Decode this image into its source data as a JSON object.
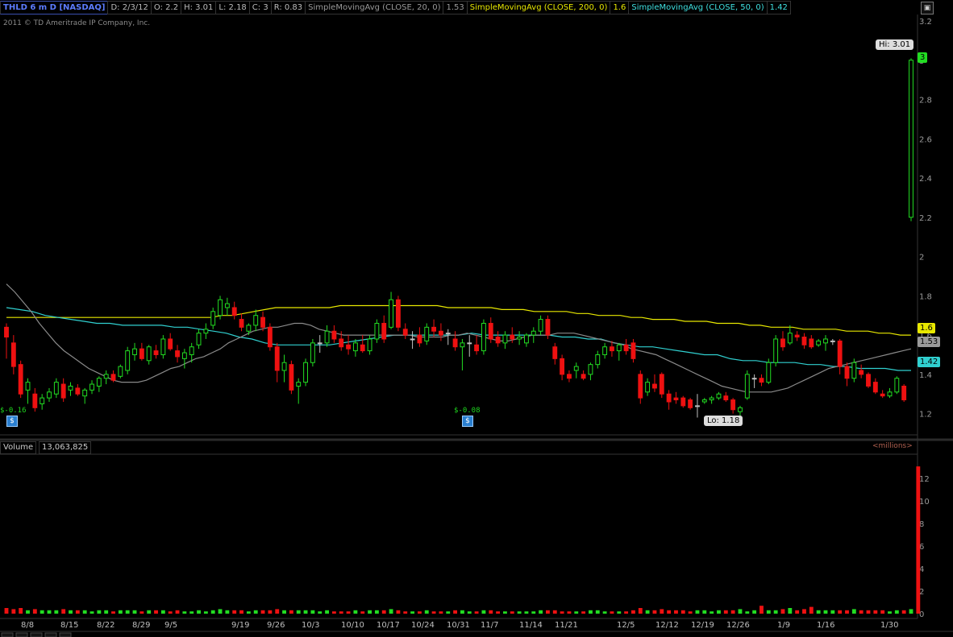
{
  "header": {
    "symbol": "THLD 6 m D [NASDAQ]",
    "date": "D: 2/3/12",
    "open": "O: 2.2",
    "high": "H: 3.01",
    "low": "L: 2.18",
    "close": "C: 3",
    "range": "R: 0.83",
    "sma20_label": "SimpleMovingAvg (CLOSE, 20, 0)",
    "sma20_value": "1.53",
    "sma200_label": "SimpleMovingAvg (CLOSE, 200, 0)",
    "sma200_value": "1.6",
    "sma50_label": "SimpleMovingAvg (CLOSE, 50, 0)",
    "sma50_value": "1.42"
  },
  "copyright": "2011 © TD Ameritrade IP Company, Inc.",
  "volume_header": {
    "label": "Volume",
    "value": "13,063,825",
    "units": "<millions>"
  },
  "annotations": {
    "hi": "Hi: 3.01",
    "lo": "Lo: 1.18",
    "earn1": "$-0.16",
    "earn2": "$-0.08",
    "earn_icon": "$",
    "tag_last": "3",
    "tag_sma200": "1.6",
    "tag_sma20": "1.53",
    "tag_sma50": "1.42"
  },
  "colors": {
    "up": "#22dd22",
    "down": "#ee1111",
    "neutral": "#c0c0c0",
    "sma20": "#8a8a8a",
    "sma200": "#e8e800",
    "sma50": "#30d0d0",
    "tag_last_bg": "#22dd22",
    "tag_sma200_bg": "#e8e800",
    "tag_sma20_bg": "#9a9a9a",
    "tag_sma50_bg": "#30d0d0"
  },
  "chart_data": {
    "type": "candlestick",
    "price_axis": {
      "ylim": [
        1.1,
        3.2
      ],
      "ticks": [
        "3.2",
        "3",
        "2.8",
        "2.6",
        "2.4",
        "2.2",
        "2",
        "1.8",
        "1.6",
        "1.4",
        "1.2"
      ]
    },
    "volume_axis": {
      "ylim": [
        0,
        14
      ],
      "ticks": [
        "12",
        "10",
        "8",
        "6",
        "4",
        "2",
        "0"
      ]
    },
    "time_axis": [
      "8/8",
      "8/15",
      "8/22",
      "8/29",
      "9/5",
      "9/19",
      "9/26",
      "10/3",
      "10/10",
      "10/17",
      "10/24",
      "10/31",
      "11/7",
      "11/14",
      "11/21",
      "12/5",
      "12/12",
      "12/19",
      "12/26",
      "1/9",
      "1/16",
      "1/30"
    ],
    "candles": [
      {
        "o": 1.64,
        "h": 1.66,
        "l": 1.48,
        "c": 1.59
      },
      {
        "o": 1.56,
        "h": 1.6,
        "l": 1.4,
        "c": 1.44
      },
      {
        "o": 1.45,
        "h": 1.47,
        "l": 1.28,
        "c": 1.3
      },
      {
        "o": 1.32,
        "h": 1.38,
        "l": 1.25,
        "c": 1.36
      },
      {
        "o": 1.3,
        "h": 1.33,
        "l": 1.21,
        "c": 1.23
      },
      {
        "o": 1.25,
        "h": 1.3,
        "l": 1.22,
        "c": 1.28
      },
      {
        "o": 1.28,
        "h": 1.33,
        "l": 1.26,
        "c": 1.31
      },
      {
        "o": 1.3,
        "h": 1.38,
        "l": 1.28,
        "c": 1.36
      },
      {
        "o": 1.35,
        "h": 1.38,
        "l": 1.26,
        "c": 1.28
      },
      {
        "o": 1.32,
        "h": 1.36,
        "l": 1.29,
        "c": 1.34
      },
      {
        "o": 1.33,
        "h": 1.35,
        "l": 1.29,
        "c": 1.3
      },
      {
        "o": 1.29,
        "h": 1.33,
        "l": 1.25,
        "c": 1.32
      },
      {
        "o": 1.32,
        "h": 1.37,
        "l": 1.3,
        "c": 1.35
      },
      {
        "o": 1.34,
        "h": 1.39,
        "l": 1.31,
        "c": 1.38
      },
      {
        "o": 1.38,
        "h": 1.42,
        "l": 1.35,
        "c": 1.4
      },
      {
        "o": 1.4,
        "h": 1.42,
        "l": 1.36,
        "c": 1.37
      },
      {
        "o": 1.39,
        "h": 1.45,
        "l": 1.38,
        "c": 1.44
      },
      {
        "o": 1.42,
        "h": 1.54,
        "l": 1.4,
        "c": 1.52
      },
      {
        "o": 1.5,
        "h": 1.56,
        "l": 1.47,
        "c": 1.53
      },
      {
        "o": 1.53,
        "h": 1.56,
        "l": 1.47,
        "c": 1.48
      },
      {
        "o": 1.47,
        "h": 1.55,
        "l": 1.45,
        "c": 1.54
      },
      {
        "o": 1.52,
        "h": 1.55,
        "l": 1.48,
        "c": 1.5
      },
      {
        "o": 1.5,
        "h": 1.6,
        "l": 1.48,
        "c": 1.58
      },
      {
        "o": 1.58,
        "h": 1.61,
        "l": 1.52,
        "c": 1.53
      },
      {
        "o": 1.52,
        "h": 1.55,
        "l": 1.46,
        "c": 1.49
      },
      {
        "o": 1.48,
        "h": 1.53,
        "l": 1.43,
        "c": 1.51
      },
      {
        "o": 1.5,
        "h": 1.56,
        "l": 1.46,
        "c": 1.54
      },
      {
        "o": 1.55,
        "h": 1.63,
        "l": 1.53,
        "c": 1.61
      },
      {
        "o": 1.61,
        "h": 1.66,
        "l": 1.58,
        "c": 1.63
      },
      {
        "o": 1.65,
        "h": 1.74,
        "l": 1.63,
        "c": 1.72
      },
      {
        "o": 1.7,
        "h": 1.8,
        "l": 1.68,
        "c": 1.78
      },
      {
        "o": 1.74,
        "h": 1.79,
        "l": 1.7,
        "c": 1.76
      },
      {
        "o": 1.74,
        "h": 1.77,
        "l": 1.68,
        "c": 1.7
      },
      {
        "o": 1.68,
        "h": 1.71,
        "l": 1.62,
        "c": 1.64
      },
      {
        "o": 1.62,
        "h": 1.66,
        "l": 1.6,
        "c": 1.65
      },
      {
        "o": 1.65,
        "h": 1.73,
        "l": 1.62,
        "c": 1.7
      },
      {
        "o": 1.69,
        "h": 1.72,
        "l": 1.62,
        "c": 1.64
      },
      {
        "o": 1.64,
        "h": 1.66,
        "l": 1.52,
        "c": 1.54
      },
      {
        "o": 1.54,
        "h": 1.56,
        "l": 1.36,
        "c": 1.42
      },
      {
        "o": 1.42,
        "h": 1.5,
        "l": 1.36,
        "c": 1.46
      },
      {
        "o": 1.45,
        "h": 1.47,
        "l": 1.3,
        "c": 1.32
      },
      {
        "o": 1.34,
        "h": 1.38,
        "l": 1.25,
        "c": 1.36
      },
      {
        "o": 1.36,
        "h": 1.48,
        "l": 1.34,
        "c": 1.46
      },
      {
        "o": 1.46,
        "h": 1.58,
        "l": 1.44,
        "c": 1.56
      },
      {
        "o": 1.56,
        "h": 1.6,
        "l": 1.51,
        "c": 1.56
      },
      {
        "o": 1.56,
        "h": 1.65,
        "l": 1.54,
        "c": 1.62
      },
      {
        "o": 1.62,
        "h": 1.65,
        "l": 1.56,
        "c": 1.58
      },
      {
        "o": 1.58,
        "h": 1.62,
        "l": 1.52,
        "c": 1.54
      },
      {
        "o": 1.55,
        "h": 1.6,
        "l": 1.5,
        "c": 1.53
      },
      {
        "o": 1.52,
        "h": 1.58,
        "l": 1.49,
        "c": 1.56
      },
      {
        "o": 1.55,
        "h": 1.6,
        "l": 1.51,
        "c": 1.52
      },
      {
        "o": 1.52,
        "h": 1.6,
        "l": 1.5,
        "c": 1.58
      },
      {
        "o": 1.58,
        "h": 1.68,
        "l": 1.56,
        "c": 1.66
      },
      {
        "o": 1.66,
        "h": 1.7,
        "l": 1.56,
        "c": 1.58
      },
      {
        "o": 1.64,
        "h": 1.82,
        "l": 1.63,
        "c": 1.78
      },
      {
        "o": 1.78,
        "h": 1.8,
        "l": 1.62,
        "c": 1.64
      },
      {
        "o": 1.63,
        "h": 1.66,
        "l": 1.58,
        "c": 1.6
      },
      {
        "o": 1.58,
        "h": 1.62,
        "l": 1.53,
        "c": 1.58
      },
      {
        "o": 1.6,
        "h": 1.64,
        "l": 1.54,
        "c": 1.56
      },
      {
        "o": 1.57,
        "h": 1.66,
        "l": 1.55,
        "c": 1.64
      },
      {
        "o": 1.64,
        "h": 1.68,
        "l": 1.59,
        "c": 1.62
      },
      {
        "o": 1.62,
        "h": 1.66,
        "l": 1.57,
        "c": 1.6
      },
      {
        "o": 1.61,
        "h": 1.63,
        "l": 1.55,
        "c": 1.61
      },
      {
        "o": 1.58,
        "h": 1.62,
        "l": 1.52,
        "c": 1.54
      },
      {
        "o": 1.54,
        "h": 1.58,
        "l": 1.42,
        "c": 1.56
      },
      {
        "o": 1.56,
        "h": 1.6,
        "l": 1.49,
        "c": 1.56
      },
      {
        "o": 1.55,
        "h": 1.6,
        "l": 1.5,
        "c": 1.52
      },
      {
        "o": 1.52,
        "h": 1.68,
        "l": 1.5,
        "c": 1.66
      },
      {
        "o": 1.66,
        "h": 1.69,
        "l": 1.56,
        "c": 1.58
      },
      {
        "o": 1.59,
        "h": 1.62,
        "l": 1.54,
        "c": 1.56
      },
      {
        "o": 1.56,
        "h": 1.62,
        "l": 1.53,
        "c": 1.6
      },
      {
        "o": 1.6,
        "h": 1.64,
        "l": 1.56,
        "c": 1.58
      },
      {
        "o": 1.58,
        "h": 1.62,
        "l": 1.55,
        "c": 1.59
      },
      {
        "o": 1.56,
        "h": 1.61,
        "l": 1.54,
        "c": 1.6
      },
      {
        "o": 1.6,
        "h": 1.64,
        "l": 1.56,
        "c": 1.62
      },
      {
        "o": 1.62,
        "h": 1.7,
        "l": 1.6,
        "c": 1.68
      },
      {
        "o": 1.68,
        "h": 1.7,
        "l": 1.58,
        "c": 1.6
      },
      {
        "o": 1.54,
        "h": 1.56,
        "l": 1.45,
        "c": 1.48
      },
      {
        "o": 1.48,
        "h": 1.5,
        "l": 1.37,
        "c": 1.4
      },
      {
        "o": 1.4,
        "h": 1.42,
        "l": 1.36,
        "c": 1.38
      },
      {
        "o": 1.42,
        "h": 1.46,
        "l": 1.38,
        "c": 1.44
      },
      {
        "o": 1.4,
        "h": 1.42,
        "l": 1.37,
        "c": 1.38
      },
      {
        "o": 1.4,
        "h": 1.46,
        "l": 1.37,
        "c": 1.45
      },
      {
        "o": 1.45,
        "h": 1.52,
        "l": 1.43,
        "c": 1.5
      },
      {
        "o": 1.5,
        "h": 1.56,
        "l": 1.48,
        "c": 1.54
      },
      {
        "o": 1.54,
        "h": 1.57,
        "l": 1.49,
        "c": 1.52
      },
      {
        "o": 1.52,
        "h": 1.56,
        "l": 1.47,
        "c": 1.55
      },
      {
        "o": 1.55,
        "h": 1.58,
        "l": 1.5,
        "c": 1.52
      },
      {
        "o": 1.56,
        "h": 1.58,
        "l": 1.46,
        "c": 1.48
      },
      {
        "o": 1.4,
        "h": 1.42,
        "l": 1.25,
        "c": 1.28
      },
      {
        "o": 1.31,
        "h": 1.38,
        "l": 1.29,
        "c": 1.36
      },
      {
        "o": 1.35,
        "h": 1.4,
        "l": 1.31,
        "c": 1.33
      },
      {
        "o": 1.4,
        "h": 1.41,
        "l": 1.28,
        "c": 1.3
      },
      {
        "o": 1.3,
        "h": 1.32,
        "l": 1.22,
        "c": 1.26
      },
      {
        "o": 1.28,
        "h": 1.31,
        "l": 1.25,
        "c": 1.27
      },
      {
        "o": 1.28,
        "h": 1.29,
        "l": 1.23,
        "c": 1.24
      },
      {
        "o": 1.27,
        "h": 1.28,
        "l": 1.22,
        "c": 1.23
      },
      {
        "o": 1.24,
        "h": 1.3,
        "l": 1.18,
        "c": 1.24
      },
      {
        "o": 1.26,
        "h": 1.28,
        "l": 1.25,
        "c": 1.27
      },
      {
        "o": 1.27,
        "h": 1.29,
        "l": 1.25,
        "c": 1.28
      },
      {
        "o": 1.28,
        "h": 1.31,
        "l": 1.27,
        "c": 1.3
      },
      {
        "o": 1.29,
        "h": 1.31,
        "l": 1.26,
        "c": 1.27
      },
      {
        "o": 1.27,
        "h": 1.28,
        "l": 1.2,
        "c": 1.22
      },
      {
        "o": 1.21,
        "h": 1.24,
        "l": 1.19,
        "c": 1.23
      },
      {
        "o": 1.28,
        "h": 1.42,
        "l": 1.27,
        "c": 1.4
      },
      {
        "o": 1.38,
        "h": 1.4,
        "l": 1.33,
        "c": 1.38
      },
      {
        "o": 1.38,
        "h": 1.4,
        "l": 1.34,
        "c": 1.36
      },
      {
        "o": 1.36,
        "h": 1.48,
        "l": 1.35,
        "c": 1.46
      },
      {
        "o": 1.46,
        "h": 1.6,
        "l": 1.44,
        "c": 1.58
      },
      {
        "o": 1.58,
        "h": 1.62,
        "l": 1.52,
        "c": 1.54
      },
      {
        "o": 1.56,
        "h": 1.65,
        "l": 1.55,
        "c": 1.61
      },
      {
        "o": 1.6,
        "h": 1.62,
        "l": 1.57,
        "c": 1.59
      },
      {
        "o": 1.59,
        "h": 1.61,
        "l": 1.53,
        "c": 1.55
      },
      {
        "o": 1.58,
        "h": 1.6,
        "l": 1.53,
        "c": 1.54
      },
      {
        "o": 1.55,
        "h": 1.58,
        "l": 1.54,
        "c": 1.57
      },
      {
        "o": 1.56,
        "h": 1.6,
        "l": 1.52,
        "c": 1.58
      },
      {
        "o": 1.57,
        "h": 1.58,
        "l": 1.55,
        "c": 1.57
      },
      {
        "o": 1.57,
        "h": 1.58,
        "l": 1.4,
        "c": 1.44
      },
      {
        "o": 1.44,
        "h": 1.46,
        "l": 1.34,
        "c": 1.38
      },
      {
        "o": 1.38,
        "h": 1.48,
        "l": 1.36,
        "c": 1.46
      },
      {
        "o": 1.42,
        "h": 1.45,
        "l": 1.38,
        "c": 1.4
      },
      {
        "o": 1.4,
        "h": 1.41,
        "l": 1.33,
        "c": 1.34
      },
      {
        "o": 1.36,
        "h": 1.38,
        "l": 1.3,
        "c": 1.31
      },
      {
        "o": 1.3,
        "h": 1.32,
        "l": 1.28,
        "c": 1.29
      },
      {
        "o": 1.29,
        "h": 1.33,
        "l": 1.28,
        "c": 1.31
      },
      {
        "o": 1.31,
        "h": 1.39,
        "l": 1.3,
        "c": 1.38
      },
      {
        "o": 1.34,
        "h": 1.35,
        "l": 1.26,
        "c": 1.27
      },
      {
        "o": 2.2,
        "h": 3.01,
        "l": 2.18,
        "c": 3.0
      }
    ],
    "volume": [
      0.5,
      0.4,
      0.5,
      0.3,
      0.4,
      0.3,
      0.3,
      0.3,
      0.4,
      0.3,
      0.3,
      0.3,
      0.2,
      0.3,
      0.3,
      0.2,
      0.3,
      0.3,
      0.3,
      0.2,
      0.3,
      0.3,
      0.3,
      0.2,
      0.3,
      0.2,
      0.2,
      0.3,
      0.2,
      0.3,
      0.4,
      0.3,
      0.3,
      0.3,
      0.2,
      0.3,
      0.3,
      0.3,
      0.4,
      0.3,
      0.3,
      0.3,
      0.3,
      0.3,
      0.2,
      0.3,
      0.2,
      0.2,
      0.2,
      0.3,
      0.2,
      0.3,
      0.3,
      0.3,
      0.4,
      0.3,
      0.2,
      0.2,
      0.2,
      0.3,
      0.2,
      0.2,
      0.2,
      0.3,
      0.3,
      0.2,
      0.2,
      0.3,
      0.3,
      0.2,
      0.2,
      0.2,
      0.2,
      0.2,
      0.2,
      0.3,
      0.3,
      0.3,
      0.2,
      0.2,
      0.2,
      0.2,
      0.3,
      0.3,
      0.2,
      0.2,
      0.2,
      0.2,
      0.3,
      0.5,
      0.3,
      0.3,
      0.4,
      0.3,
      0.3,
      0.3,
      0.2,
      0.3,
      0.3,
      0.2,
      0.3,
      0.3,
      0.3,
      0.4,
      0.2,
      0.3,
      0.7,
      0.3,
      0.3,
      0.4,
      0.5,
      0.3,
      0.4,
      0.6,
      0.3,
      0.3,
      0.3,
      0.3,
      0.3,
      0.4,
      0.3,
      0.3,
      0.3,
      0.3,
      0.2,
      0.3,
      0.3,
      0.4,
      13.06
    ],
    "sma20": [
      1.86,
      1.82,
      1.77,
      1.72,
      1.66,
      1.61,
      1.56,
      1.52,
      1.49,
      1.46,
      1.43,
      1.41,
      1.39,
      1.37,
      1.36,
      1.36,
      1.36,
      1.37,
      1.39,
      1.41,
      1.43,
      1.44,
      1.46,
      1.48,
      1.49,
      1.51,
      1.53,
      1.56,
      1.58,
      1.6,
      1.62,
      1.63,
      1.64,
      1.64,
      1.65,
      1.66,
      1.66,
      1.65,
      1.63,
      1.62,
      1.61,
      1.6,
      1.6,
      1.6,
      1.6,
      1.6,
      1.6,
      1.6,
      1.6,
      1.6,
      1.59,
      1.59,
      1.59,
      1.59,
      1.6,
      1.6,
      1.61,
      1.6,
      1.59,
      1.58,
      1.57,
      1.57,
      1.58,
      1.59,
      1.6,
      1.6,
      1.6,
      1.61,
      1.61,
      1.61,
      1.6,
      1.59,
      1.58,
      1.57,
      1.56,
      1.55,
      1.53,
      1.52,
      1.51,
      1.5,
      1.48,
      1.46,
      1.44,
      1.42,
      1.4,
      1.38,
      1.36,
      1.34,
      1.33,
      1.32,
      1.31,
      1.31,
      1.31,
      1.31,
      1.32,
      1.33,
      1.35,
      1.37,
      1.39,
      1.41,
      1.43,
      1.44,
      1.45,
      1.46,
      1.47,
      1.48,
      1.49,
      1.5,
      1.51,
      1.52,
      1.53
    ],
    "sma200": [
      1.69,
      1.69,
      1.69,
      1.69,
      1.69,
      1.69,
      1.69,
      1.69,
      1.69,
      1.69,
      1.69,
      1.69,
      1.69,
      1.69,
      1.69,
      1.69,
      1.69,
      1.69,
      1.69,
      1.69,
      1.7,
      1.7,
      1.71,
      1.72,
      1.73,
      1.74,
      1.74,
      1.74,
      1.74,
      1.74,
      1.74,
      1.75,
      1.75,
      1.75,
      1.75,
      1.75,
      1.75,
      1.75,
      1.75,
      1.75,
      1.75,
      1.74,
      1.74,
      1.74,
      1.74,
      1.74,
      1.73,
      1.73,
      1.73,
      1.72,
      1.72,
      1.72,
      1.72,
      1.71,
      1.71,
      1.7,
      1.7,
      1.7,
      1.69,
      1.69,
      1.68,
      1.68,
      1.68,
      1.67,
      1.67,
      1.67,
      1.66,
      1.66,
      1.66,
      1.65,
      1.65,
      1.64,
      1.64,
      1.64,
      1.63,
      1.63,
      1.63,
      1.63,
      1.62,
      1.62,
      1.62,
      1.61,
      1.61,
      1.6,
      1.6
    ],
    "sma50": [
      1.74,
      1.73,
      1.72,
      1.7,
      1.69,
      1.68,
      1.67,
      1.66,
      1.66,
      1.65,
      1.65,
      1.65,
      1.65,
      1.64,
      1.64,
      1.63,
      1.62,
      1.61,
      1.59,
      1.58,
      1.56,
      1.55,
      1.55,
      1.55,
      1.55,
      1.55,
      1.56,
      1.57,
      1.58,
      1.59,
      1.6,
      1.6,
      1.6,
      1.6,
      1.6,
      1.6,
      1.61,
      1.6,
      1.6,
      1.6,
      1.6,
      1.6,
      1.6,
      1.59,
      1.59,
      1.58,
      1.58,
      1.56,
      1.55,
      1.54,
      1.54,
      1.53,
      1.52,
      1.51,
      1.5,
      1.5,
      1.48,
      1.47,
      1.47,
      1.46,
      1.46,
      1.46,
      1.45,
      1.45,
      1.44,
      1.44,
      1.43,
      1.43,
      1.43,
      1.42,
      1.42
    ]
  }
}
